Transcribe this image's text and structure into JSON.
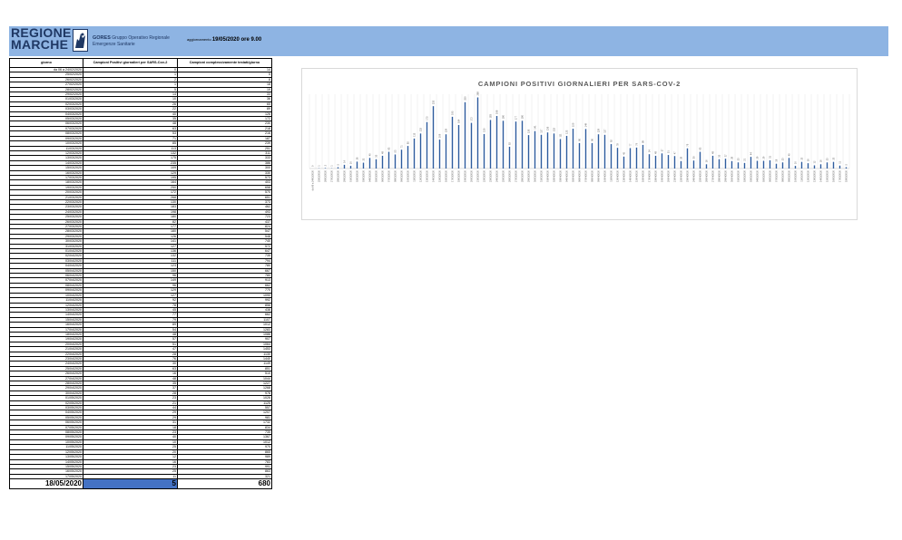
{
  "header": {
    "logo_line1": "REGIONE",
    "logo_line2": "MARCHE",
    "gores_name": "GORES",
    "gores_desc1": "Gruppo Operativo Regionale",
    "gores_desc2": "Emergenze Sanitarie",
    "update_label": "aggiornamento",
    "update_value": "19/05/2020 ore 9.00"
  },
  "table": {
    "headers": [
      "giorno",
      "Campioni Positivi giornalieri per SARS-Cov-2",
      "Campioni complessivamente testati/giorno"
    ],
    "rows": [
      [
        "da 06 a 24/02/2020",
        "0",
        "14"
      ],
      [
        "25/02/2020",
        "1",
        "5"
      ],
      [
        "26/02/2020",
        "2",
        "8"
      ],
      [
        "27/02/2020",
        "1",
        "18"
      ],
      [
        "28/02/2020",
        "5",
        "19"
      ],
      [
        "29/02/2020",
        "14",
        "33"
      ],
      [
        "01/03/2020",
        "10",
        "36"
      ],
      [
        "02/03/2020",
        "26",
        "65"
      ],
      [
        "03/03/2020",
        "22",
        "89"
      ],
      [
        "04/03/2020",
        "40",
        "126"
      ],
      [
        "05/03/2020",
        "35",
        "172"
      ],
      [
        "06/03/2020",
        "48",
        "230"
      ],
      [
        "07/03/2020",
        "63",
        "218"
      ],
      [
        "08/03/2020",
        "53",
        "216"
      ],
      [
        "09/03/2020",
        "71",
        "187"
      ],
      [
        "10/03/2020",
        "85",
        "239"
      ],
      [
        "11/03/2020",
        "113",
        "251"
      ],
      [
        "12/03/2020",
        "132",
        "311"
      ],
      [
        "13/03/2020",
        "175",
        "333"
      ],
      [
        "14/03/2020",
        "235",
        "386"
      ],
      [
        "15/03/2020",
        "109",
        "300"
      ],
      [
        "16/03/2020",
        "129",
        "330"
      ],
      [
        "17/03/2020",
        "195",
        "573"
      ],
      [
        "18/03/2020",
        "164",
        "403"
      ],
      [
        "19/03/2020",
        "250",
        "658"
      ],
      [
        "20/03/2020",
        "172",
        "570"
      ],
      [
        "21/03/2020",
        "268",
        "651"
      ],
      [
        "22/03/2020",
        "130",
        "373"
      ],
      [
        "23/03/2020",
        "183",
        "462"
      ],
      [
        "24/03/2020",
        "198",
        "493"
      ],
      [
        "25/03/2020",
        "180",
        "723"
      ],
      [
        "26/03/2020",
        "82",
        "437"
      ],
      [
        "27/03/2020",
        "177",
        "824"
      ],
      [
        "28/03/2020",
        "180",
        "547"
      ],
      [
        "29/03/2020",
        "126",
        "548"
      ],
      [
        "30/03/2020",
        "141",
        "740"
      ],
      [
        "31/03/2020",
        "127",
        "572"
      ],
      [
        "01/04/2020",
        "136",
        "647"
      ],
      [
        "02/04/2020",
        "132",
        "735"
      ],
      [
        "03/04/2020",
        "111",
        "794"
      ],
      [
        "04/04/2020",
        "123",
        "780"
      ],
      [
        "05/04/2020",
        "150",
        "667"
      ],
      [
        "06/04/2020",
        "96",
        "780"
      ],
      [
        "07/04/2020",
        "149",
        "913"
      ],
      [
        "08/04/2020",
        "96",
        "662"
      ],
      [
        "09/04/2020",
        "129",
        "770"
      ],
      [
        "10/04/2020",
        "127",
        "1090"
      ],
      [
        "11/04/2020",
        "92",
        "992"
      ],
      [
        "12/04/2020",
        "78",
        "856"
      ],
      [
        "13/04/2020",
        "45",
        "438"
      ],
      [
        "14/04/2020",
        "77",
        "662"
      ],
      [
        "15/04/2020",
        "79",
        "1107"
      ],
      [
        "16/04/2020",
        "89",
        "1012"
      ],
      [
        "17/04/2020",
        "54",
        "1283"
      ],
      [
        "18/04/2020",
        "48",
        "1086"
      ],
      [
        "19/04/2020",
        "57",
        "907"
      ],
      [
        "20/04/2020",
        "51",
        "1064"
      ],
      [
        "21/04/2020",
        "47",
        "1453"
      ],
      [
        "22/04/2020",
        "28",
        "1130"
      ],
      [
        "23/04/2020",
        "76",
        "1440"
      ],
      [
        "24/04/2020",
        "30",
        "1149"
      ],
      [
        "25/04/2020",
        "63",
        "851"
      ],
      [
        "26/04/2020",
        "16",
        "510"
      ],
      [
        "27/04/2020",
        "48",
        "1044"
      ],
      [
        "28/04/2020",
        "35",
        "1227"
      ],
      [
        "29/04/2020",
        "37",
        "1268"
      ],
      [
        "30/04/2020",
        "28",
        "978"
      ],
      [
        "01/05/2020",
        "23",
        "1026"
      ],
      [
        "02/05/2020",
        "21",
        "1125"
      ],
      [
        "03/05/2020",
        "44",
        "557"
      ],
      [
        "04/05/2020",
        "29",
        "1207"
      ],
      [
        "05/05/2020",
        "29",
        "981"
      ],
      [
        "06/05/2020",
        "31",
        "1732"
      ],
      [
        "07/05/2020",
        "18",
        "834"
      ],
      [
        "08/05/2020",
        "23",
        "735"
      ],
      [
        "09/05/2020",
        "40",
        "1367"
      ],
      [
        "10/05/2020",
        "10",
        "1012"
      ],
      [
        "11/05/2020",
        "25",
        "970"
      ],
      [
        "12/05/2020",
        "20",
        "865"
      ],
      [
        "13/05/2020",
        "12",
        "989"
      ],
      [
        "14/05/2020",
        "16",
        "783"
      ],
      [
        "15/05/2020",
        "23",
        "991"
      ],
      [
        "16/05/2020",
        "25",
        "863"
      ],
      [
        "17/05/2020",
        "11",
        "321"
      ]
    ],
    "last_row": [
      "18/05/2020",
      "5",
      "680"
    ]
  },
  "chart_data": {
    "type": "bar",
    "title": "CAMPIONI POSITIVI GIORNALIERI PER SARS-COV-2",
    "categories": [
      "da 06 a 24/02/2020",
      "25/02/2020",
      "26/02/2020",
      "27/02/2020",
      "28/02/2020",
      "29/02/2020",
      "01/03/2020",
      "02/03/2020",
      "03/03/2020",
      "04/03/2020",
      "05/03/2020",
      "06/03/2020",
      "07/03/2020",
      "08/03/2020",
      "09/03/2020",
      "10/03/2020",
      "11/03/2020",
      "12/03/2020",
      "13/03/2020",
      "14/03/2020",
      "15/03/2020",
      "16/03/2020",
      "17/03/2020",
      "18/03/2020",
      "19/03/2020",
      "20/03/2020",
      "21/03/2020",
      "22/03/2020",
      "23/03/2020",
      "24/03/2020",
      "25/03/2020",
      "26/03/2020",
      "27/03/2020",
      "28/03/2020",
      "29/03/2020",
      "30/03/2020",
      "31/03/2020",
      "01/04/2020",
      "02/04/2020",
      "03/04/2020",
      "04/04/2020",
      "05/04/2020",
      "06/04/2020",
      "07/04/2020",
      "08/04/2020",
      "09/04/2020",
      "10/04/2020",
      "11/04/2020",
      "12/04/2020",
      "13/04/2020",
      "14/04/2020",
      "15/04/2020",
      "16/04/2020",
      "17/04/2020",
      "18/04/2020",
      "19/04/2020",
      "20/04/2020",
      "21/04/2020",
      "22/04/2020",
      "23/04/2020",
      "24/04/2020",
      "25/04/2020",
      "26/04/2020",
      "27/04/2020",
      "28/04/2020",
      "29/04/2020",
      "30/04/2020",
      "01/05/2020",
      "02/05/2020",
      "03/05/2020",
      "04/05/2020",
      "05/05/2020",
      "06/05/2020",
      "07/05/2020",
      "08/05/2020",
      "09/05/2020",
      "10/05/2020",
      "11/05/2020",
      "12/05/2020",
      "13/05/2020",
      "14/05/2020",
      "15/05/2020",
      "16/05/2020",
      "17/05/2020",
      "18/05/2020"
    ],
    "values": [
      0,
      1,
      2,
      1,
      5,
      14,
      10,
      26,
      22,
      40,
      35,
      48,
      63,
      53,
      71,
      85,
      113,
      132,
      175,
      235,
      109,
      129,
      195,
      164,
      250,
      172,
      268,
      130,
      183,
      198,
      180,
      82,
      177,
      180,
      126,
      141,
      127,
      136,
      132,
      111,
      123,
      150,
      96,
      149,
      96,
      129,
      127,
      92,
      78,
      45,
      77,
      79,
      89,
      54,
      48,
      57,
      51,
      47,
      28,
      76,
      30,
      63,
      16,
      48,
      35,
      37,
      28,
      23,
      21,
      44,
      29,
      29,
      31,
      18,
      23,
      40,
      10,
      25,
      20,
      12,
      16,
      23,
      25,
      11,
      5
    ],
    "ylim": [
      0,
      280
    ],
    "grid": true,
    "bar_color": "#2e5c9e"
  }
}
